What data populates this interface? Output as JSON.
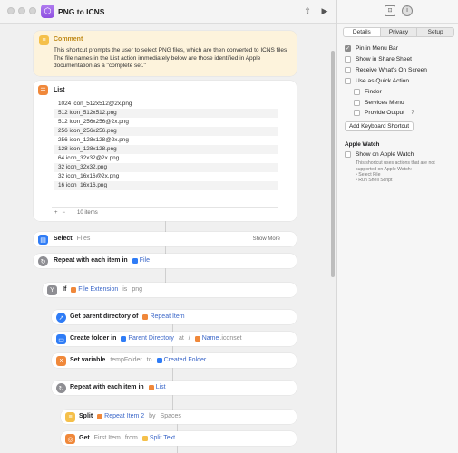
{
  "window": {
    "title": "PNG to ICNS"
  },
  "comment": {
    "header": "Comment",
    "text": "This shortcut prompts the user to select PNG files, which are then converted to ICNS files The file names in the List action immediately below are those identified in Apple documentation as a \"complete set.\""
  },
  "list": {
    "header": "List",
    "items": [
      "1024 icon_512x512@2x.png",
      "512 icon_512x512.png",
      "512 icon_256x256@2x.png",
      "256 icon_256x256.png",
      "256 icon_128x128@2x.png",
      "128 icon_128x128.png",
      "64 icon_32x32@2x.png",
      "32 icon_32x32.png",
      "32 icon_16x16@2x.png",
      "16 icon_16x16.png"
    ],
    "add": "+",
    "remove": "−",
    "count": "10 items"
  },
  "actions": {
    "select": {
      "label": "Select",
      "value": "Files",
      "more": "Show More"
    },
    "repeat1": {
      "label": "Repeat with each item in",
      "token": "File"
    },
    "if": {
      "label": "If",
      "token": "File Extension",
      "op": "is",
      "value": "png"
    },
    "parentdir": {
      "label": "Get parent directory of",
      "token": "Repeat Item"
    },
    "createfolder": {
      "label": "Create folder in",
      "token1": "Parent Directory",
      "at": "at",
      "slash": "/",
      "token2": "Name",
      "suffix": ".iconset"
    },
    "setvar": {
      "label": "Set variable",
      "var": "tempFolder",
      "to": "to",
      "token": "Created Folder"
    },
    "repeat2": {
      "label": "Repeat with each item in",
      "token": "List"
    },
    "split": {
      "label": "Split",
      "token": "Repeat Item 2",
      "by": "by",
      "value": "Spaces"
    },
    "get": {
      "label": "Get",
      "value": "First Item",
      "from": "from",
      "token": "Split Text"
    }
  },
  "inspector": {
    "tabs": [
      "Details",
      "Privacy",
      "Setup"
    ],
    "options": {
      "pin_menu_bar": "Pin in Menu Bar",
      "share_sheet": "Show in Share Sheet",
      "receive_screen": "Receive What's On Screen",
      "quick_action": "Use as Quick Action",
      "finder": "Finder",
      "services": "Services Menu",
      "provide_output": "Provide Output",
      "help": "?"
    },
    "add_shortcut": "Add Keyboard Shortcut",
    "apple_watch": {
      "header": "Apple Watch",
      "option": "Show on Apple Watch",
      "note": "This shortcut uses actions that are not supported on Apple Watch:",
      "bullets": [
        "• Select File",
        "• Run Shell Script"
      ]
    }
  },
  "colors": {
    "accent_blue": "#2f7cf6",
    "orange": "#f0883a",
    "purple": "#9b59e8",
    "gray_icon": "#8e8e93"
  }
}
